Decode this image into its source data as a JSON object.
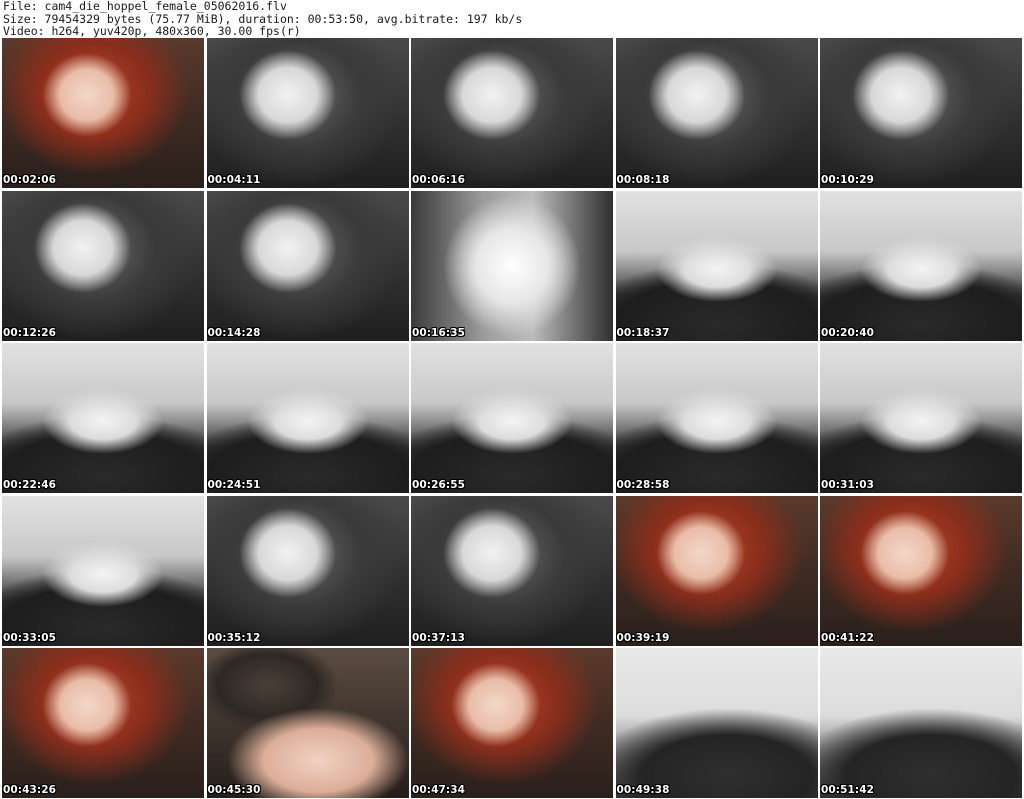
{
  "header": {
    "line1": "File: cam4_die_hoppel_female_05062016.flv",
    "line2": "Size: 79454329 bytes (75.77 MiB), duration: 00:53:50, avg.bitrate: 197 kb/s",
    "line3": "Video: h264, yuv420p, 480x360, 30.00 fps(r)"
  },
  "thumbnails": [
    {
      "timestamp": "00:02:06",
      "scene": "portrait-color"
    },
    {
      "timestamp": "00:04:11",
      "scene": "portrait-gray"
    },
    {
      "timestamp": "00:06:16",
      "scene": "portrait-gray"
    },
    {
      "timestamp": "00:08:18",
      "scene": "portrait-gray"
    },
    {
      "timestamp": "00:10:29",
      "scene": "portrait-gray"
    },
    {
      "timestamp": "00:12:26",
      "scene": "portrait-gray"
    },
    {
      "timestamp": "00:14:28",
      "scene": "portrait-gray"
    },
    {
      "timestamp": "00:16:35",
      "scene": "blur-gray"
    },
    {
      "timestamp": "00:18:37",
      "scene": "torso-gray"
    },
    {
      "timestamp": "00:20:40",
      "scene": "torso-gray"
    },
    {
      "timestamp": "00:22:46",
      "scene": "torso-gray"
    },
    {
      "timestamp": "00:24:51",
      "scene": "torso-gray"
    },
    {
      "timestamp": "00:26:55",
      "scene": "torso-gray"
    },
    {
      "timestamp": "00:28:58",
      "scene": "torso-gray"
    },
    {
      "timestamp": "00:31:03",
      "scene": "torso-gray"
    },
    {
      "timestamp": "00:33:05",
      "scene": "torso-gray"
    },
    {
      "timestamp": "00:35:12",
      "scene": "portrait-gray"
    },
    {
      "timestamp": "00:37:13",
      "scene": "portrait-gray"
    },
    {
      "timestamp": "00:39:19",
      "scene": "portrait-color"
    },
    {
      "timestamp": "00:41:22",
      "scene": "portrait-color"
    },
    {
      "timestamp": "00:43:26",
      "scene": "portrait-color"
    },
    {
      "timestamp": "00:45:30",
      "scene": "couch-color"
    },
    {
      "timestamp": "00:47:34",
      "scene": "portrait-color"
    },
    {
      "timestamp": "00:49:38",
      "scene": "couch-gray"
    },
    {
      "timestamp": "00:51:42",
      "scene": "couch-gray"
    }
  ]
}
